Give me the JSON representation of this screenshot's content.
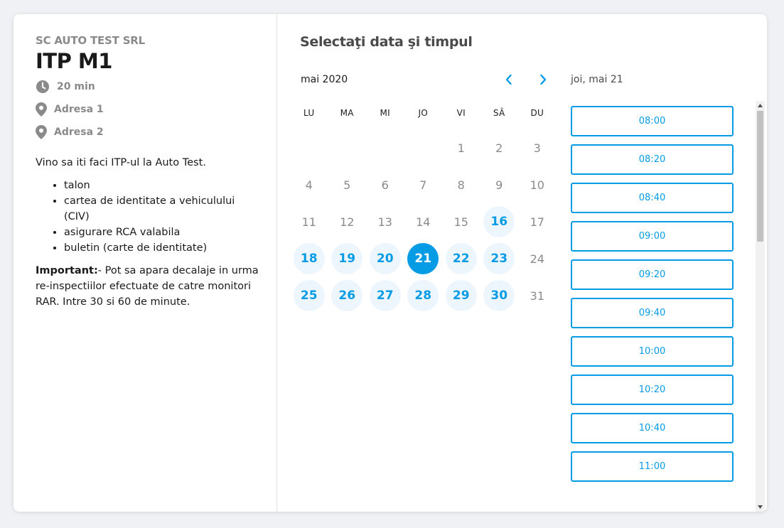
{
  "event": {
    "company": "SC AUTO TEST SRL",
    "title": "ITP M1",
    "duration": "20 min",
    "locations": [
      "Adresa 1",
      "Adresa 2"
    ],
    "description_intro": "Vino sa iti faci ITP-ul la Auto Test.",
    "requirements": [
      "talon",
      "cartea de identitate a vehiculului (CIV)",
      "asigurare RCA valabila",
      "buletin (carte de identitate)"
    ],
    "important_label": "Important:",
    "important_text": "- Pot sa apara decalaje in urma re-inspectiilor efectuate de catre monitori RAR. Intre 30 si 60 de minute."
  },
  "calendar": {
    "heading": "Selectaţi data şi timpul",
    "month_label": "mai 2020",
    "weekdays": [
      "LU",
      "MA",
      "MI",
      "JO",
      "VI",
      "SÂ",
      "DU"
    ],
    "weeks": [
      [
        null,
        null,
        null,
        null,
        {
          "d": "1",
          "s": "off"
        },
        {
          "d": "2",
          "s": "off"
        },
        {
          "d": "3",
          "s": "off"
        }
      ],
      [
        {
          "d": "4",
          "s": "off"
        },
        {
          "d": "5",
          "s": "off"
        },
        {
          "d": "6",
          "s": "off"
        },
        {
          "d": "7",
          "s": "off"
        },
        {
          "d": "8",
          "s": "off"
        },
        {
          "d": "9",
          "s": "off"
        },
        {
          "d": "10",
          "s": "off"
        }
      ],
      [
        {
          "d": "11",
          "s": "off"
        },
        {
          "d": "12",
          "s": "off"
        },
        {
          "d": "13",
          "s": "off"
        },
        {
          "d": "14",
          "s": "off"
        },
        {
          "d": "15",
          "s": "off"
        },
        {
          "d": "16",
          "s": "available"
        },
        {
          "d": "17",
          "s": "off"
        }
      ],
      [
        {
          "d": "18",
          "s": "available"
        },
        {
          "d": "19",
          "s": "available"
        },
        {
          "d": "20",
          "s": "available"
        },
        {
          "d": "21",
          "s": "selected"
        },
        {
          "d": "22",
          "s": "available"
        },
        {
          "d": "23",
          "s": "available"
        },
        {
          "d": "24",
          "s": "off"
        }
      ],
      [
        {
          "d": "25",
          "s": "available"
        },
        {
          "d": "26",
          "s": "available"
        },
        {
          "d": "27",
          "s": "available"
        },
        {
          "d": "28",
          "s": "available"
        },
        {
          "d": "29",
          "s": "available"
        },
        {
          "d": "30",
          "s": "available"
        },
        {
          "d": "31",
          "s": "off"
        }
      ]
    ],
    "prev_icon": "chevron-left-icon",
    "next_icon": "chevron-right-icon"
  },
  "times": {
    "selected_date_label": "joi, mai 21",
    "slots": [
      "08:00",
      "08:20",
      "08:40",
      "09:00",
      "09:20",
      "09:40",
      "10:00",
      "10:20",
      "10:40",
      "11:00"
    ]
  },
  "colors": {
    "accent": "#069be5",
    "available_bg": "#eef6fd",
    "muted_text": "#8a8a8a"
  }
}
